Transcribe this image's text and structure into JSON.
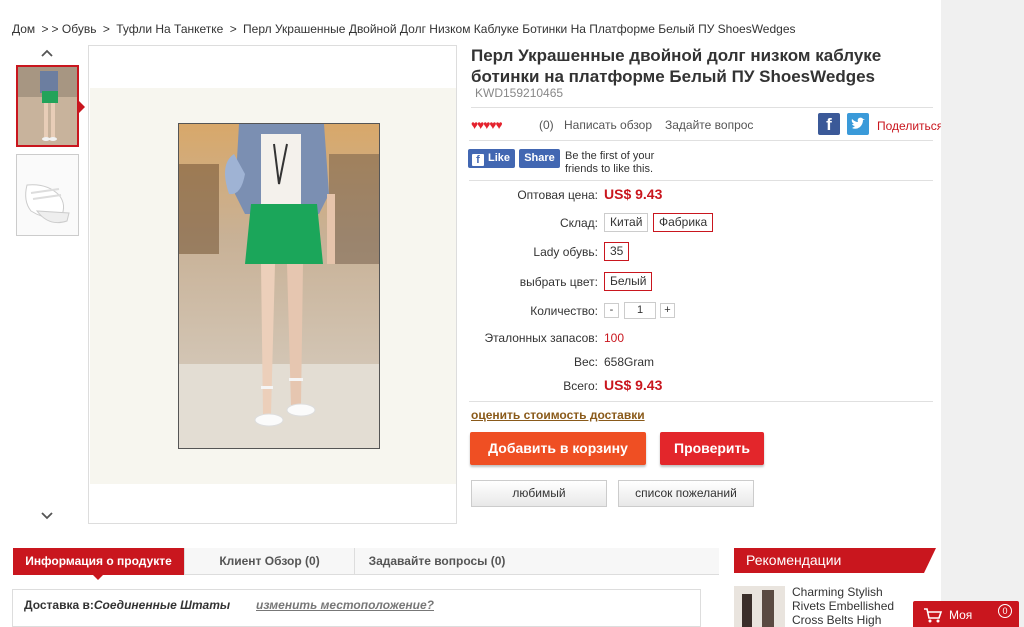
{
  "breadcrumb": {
    "home": "Дом",
    "sep1": ">",
    "sep2": ">",
    "cat1": "Обувь",
    "cat2": "Туфли На Танкетке",
    "current": "Перл Украшенные Двойной Долг Низком Каблуке Ботинки На Платформе Белый ПУ ShoesWedges"
  },
  "product": {
    "title": "Перл Украшенные двойной долг низком каблуке ботинки на платформе Белый ПУ ShoesWedges",
    "sku": "KWD159210465",
    "stars": "♥♥♥♥♥",
    "review_count": "(0)",
    "write_review": "Написать обзор",
    "ask_question": "Задайте вопрос",
    "share": "Поделиться"
  },
  "facebook": {
    "like": "Like",
    "share": "Share",
    "text": "Be the first of your friends to like this."
  },
  "details": {
    "wholesale_label": "Оптовая цена:",
    "wholesale_price": "US$ 9.43",
    "warehouse_label": "Склад:",
    "warehouse_options": [
      "Китай",
      "Фабрика"
    ],
    "warehouse_selected": "Фабрика",
    "size_label": "Lady обувь:",
    "size_value": "35",
    "color_label": "выбрать цвет:",
    "color_value": "Белый",
    "qty_label": "Количество:",
    "qty_minus": "-",
    "qty_value": "1",
    "qty_plus": "+",
    "stock_label": "Эталонных запасов:",
    "stock_value": "100",
    "weight_label": "Вес:",
    "weight_value": "658Gram",
    "total_label": "Всего:",
    "total_price": "US$ 9.43"
  },
  "actions": {
    "shipping_estimate": "оценить стоимость доставки",
    "add_to_cart": "Добавить в корзину",
    "checkout": "Проверить",
    "favorite": "любимый",
    "wishlist": "список пожеланий"
  },
  "tabs": [
    {
      "label": "Информация о продукте",
      "active": true
    },
    {
      "label": "Клиент Обзор (0)",
      "active": false
    },
    {
      "label": "Задавайте вопросы (0)",
      "active": false
    }
  ],
  "shipping": {
    "prefix": "Доставка в:",
    "country": "Соединенные Штаты",
    "change": "изменить местоположение?"
  },
  "recommendations": {
    "header": "Рекомендации",
    "item1_line1": "Charming Stylish",
    "item1_line2": "Rivets Embellished",
    "item1_line3": "Cross Belts High"
  },
  "cart": {
    "label": "Моя",
    "count": "0"
  },
  "colors": {
    "accent_red": "#c9161e",
    "cart_orange": "#ef4f23",
    "facebook_blue": "#4267b2"
  }
}
